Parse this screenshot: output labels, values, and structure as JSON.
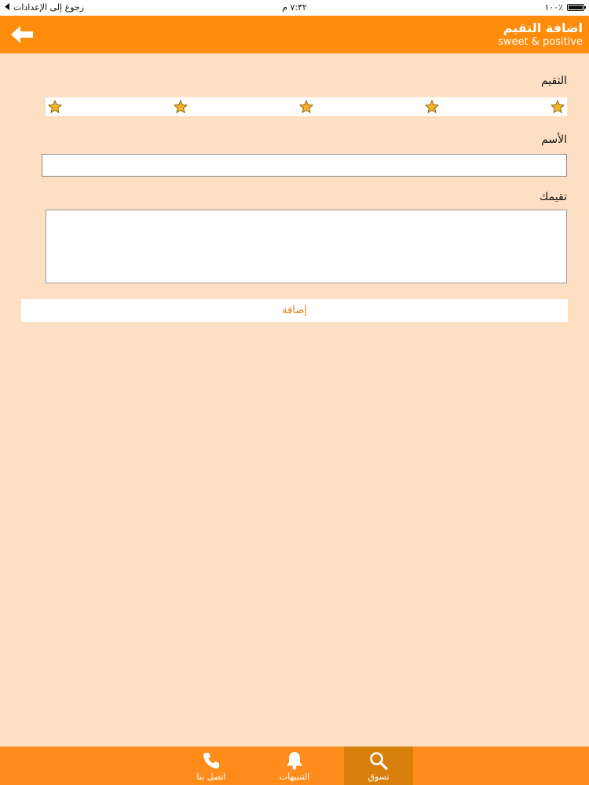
{
  "status_bar": {
    "back_to_settings": "رجوع إلى الإعدادات",
    "time": "٧:٣٢ م",
    "battery_text": "١٠٠٪",
    "battery_level": 1.0
  },
  "nav": {
    "title": "اضافة التقيم",
    "subtitle": "sweet & positive",
    "back_icon": "arrow-left-icon"
  },
  "form": {
    "rating_label": "التقيم",
    "rating_stars": 5,
    "name_label": "الأسم",
    "name_value": "",
    "review_label": "تقيمك",
    "review_value": "",
    "submit_label": "إضافة"
  },
  "colors": {
    "nav_background": "#ff8c0a",
    "page_background": "#fde0c4",
    "tab_bar_background": "#ff8c1a",
    "tab_active_background": "#d8800e",
    "star_fill": "#f2b32a",
    "accent_text": "#e07a10"
  },
  "tab_bar": {
    "tabs": [
      {
        "label": "تسوق",
        "icon": "search-icon",
        "active": true
      },
      {
        "label": "التنبيهات",
        "icon": "bell-icon",
        "active": false
      },
      {
        "label": "اتصل بنا",
        "icon": "phone-icon",
        "active": false
      }
    ]
  }
}
